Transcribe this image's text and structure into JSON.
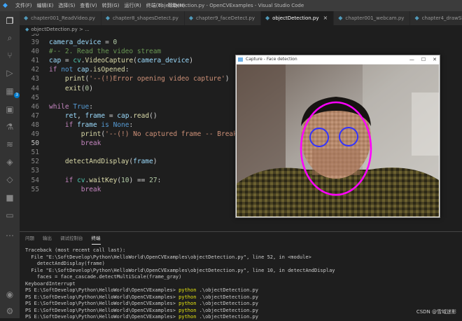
{
  "titlebar": {
    "menu": [
      "文件(F)",
      "编辑(E)",
      "选择(S)",
      "查看(V)",
      "转到(G)",
      "运行(R)",
      "终端(T)",
      "帮助(H)"
    ],
    "window_title": "objectDetection.py - OpenCVExamples - Visual Studio Code"
  },
  "activity_bar": {
    "icons": [
      "files-icon",
      "search-icon",
      "source-control-icon",
      "run-debug-icon",
      "extensions-icon",
      "remote-icon",
      "testing-icon",
      "database-icon",
      "layers-icon",
      "git-lens-icon",
      "docker-icon",
      "folder-icon",
      "more-icon",
      "account-icon",
      "settings-icon"
    ],
    "extensions_badge": "3"
  },
  "tabs": [
    {
      "label": "chapter001_ReadVideo.py",
      "active": false
    },
    {
      "label": "chapter8_shapesDetect.py",
      "active": false
    },
    {
      "label": "chapter9_faceDetect.py",
      "active": false
    },
    {
      "label": "objectDetection.py",
      "active": true
    },
    {
      "label": "chapter001_webcam.py",
      "active": false
    },
    {
      "label": "chapter4_drawShapes.py",
      "active": false
    }
  ],
  "breadcrumb": {
    "file": "objectDetection.py",
    "suffix": "> ..."
  },
  "editor": {
    "current_line": 50,
    "lines": [
      {
        "n": "39",
        "html": "<span class='var'>camera_device</span><span class='plain'> = </span><span class='num'>0</span>"
      },
      {
        "n": "40",
        "html": "<span class='cm'>#-- 2. Read the video stream</span>"
      },
      {
        "n": "41",
        "html": "<span class='var'>cap</span><span class='plain'> = </span><span class='cls'>cv</span><span class='plain'>.</span><span class='fn'>VideoCapture</span><span class='plain'>(</span><span class='var'>camera_device</span><span class='plain'>)</span>"
      },
      {
        "n": "42",
        "html": "<span class='kw'>if</span><span class='plain'> </span><span class='kw2'>not</span><span class='plain'> </span><span class='var'>cap</span><span class='plain'>.</span><span class='fn'>isOpened</span><span class='plain'>:</span>"
      },
      {
        "n": "43",
        "html": "<span class='plain'>    </span><span class='fn'>print</span><span class='plain'>(</span><span class='str'>'--(!)Error opening video capture'</span><span class='plain'>)</span>"
      },
      {
        "n": "44",
        "html": "<span class='plain'>    </span><span class='fn'>exit</span><span class='plain'>(</span><span class='num'>0</span><span class='plain'>)</span>"
      },
      {
        "n": "45",
        "html": ""
      },
      {
        "n": "46",
        "html": "<span class='kw'>while</span><span class='plain'> </span><span class='kw2'>True</span><span class='plain'>:</span>"
      },
      {
        "n": "47",
        "html": "<span class='plain'>    </span><span class='var'>ret</span><span class='plain'>, </span><span class='var'>frame</span><span class='plain'> = </span><span class='var'>cap</span><span class='plain'>.</span><span class='fn'>read</span><span class='plain'>()</span>"
      },
      {
        "n": "48",
        "html": "<span class='plain'>    </span><span class='kw'>if</span><span class='plain'> </span><span class='var'>frame</span><span class='plain'> </span><span class='kw2'>is</span><span class='plain'> </span><span class='kw2'>None</span><span class='plain'>:</span>"
      },
      {
        "n": "49",
        "html": "<span class='plain'>        </span><span class='fn'>print</span><span class='plain'>(</span><span class='str'>'--(!) No captured frame -- Break!'</span>"
      },
      {
        "n": "50",
        "html": "<span class='plain'>        </span><span class='kw'>break</span>"
      },
      {
        "n": "51",
        "html": ""
      },
      {
        "n": "52",
        "html": "<span class='plain'>    </span><span class='fn'>detectAndDisplay</span><span class='plain'>(</span><span class='var'>frame</span><span class='plain'>)</span>"
      },
      {
        "n": "53",
        "html": ""
      },
      {
        "n": "54",
        "html": "<span class='plain'>    </span><span class='kw'>if</span><span class='plain'> </span><span class='cls'>cv</span><span class='plain'>.</span><span class='fn'>waitKey</span><span class='plain'>(</span><span class='num'>10</span><span class='plain'>) == </span><span class='num'>27</span><span class='plain'>:</span>"
      },
      {
        "n": "55",
        "html": "<span class='plain'>        </span><span class='kw'>break</span>"
      }
    ]
  },
  "capture_window": {
    "title": "Capture - Face detection",
    "buttons": {
      "min": "—",
      "max": "☐",
      "close": "✕"
    }
  },
  "panel": {
    "tabs": [
      "问题",
      "输出",
      "调试控制台",
      "终端"
    ],
    "active_tab": "终端",
    "terminal_lines": [
      {
        "pre": "Traceback (most recent call last):",
        "cmd": "",
        "post": ""
      },
      {
        "pre": "  File \"E:\\SoftDevelop\\Python\\HelloWorld\\OpenCVExamples\\objectDetection.py\", line 52, in <module>",
        "cmd": "",
        "post": ""
      },
      {
        "pre": "    detectAndDisplay(frame)",
        "cmd": "",
        "post": ""
      },
      {
        "pre": "  File \"E:\\SoftDevelop\\Python\\HelloWorld\\OpenCVExamples\\objectDetection.py\", line 10, in detectAndDisplay",
        "cmd": "",
        "post": ""
      },
      {
        "pre": "    faces = face_cascade.detectMultiScale(frame_gray)",
        "cmd": "",
        "post": ""
      },
      {
        "pre": "KeyboardInterrupt",
        "cmd": "",
        "post": ""
      },
      {
        "pre": "PS E:\\SoftDevelop\\Python\\HelloWorld\\OpenCVExamples> ",
        "cmd": "python",
        "post": " .\\objectDetection.py"
      },
      {
        "pre": "PS E:\\SoftDevelop\\Python\\HelloWorld\\OpenCVExamples> ",
        "cmd": "python",
        "post": " .\\objectDetection.py"
      },
      {
        "pre": "PS E:\\SoftDevelop\\Python\\HelloWorld\\OpenCVExamples> ",
        "cmd": "python",
        "post": " .\\objectDetection.py"
      },
      {
        "pre": "PS E:\\SoftDevelop\\Python\\HelloWorld\\OpenCVExamples> ",
        "cmd": "python",
        "post": " .\\objectDetection.py"
      },
      {
        "pre": "PS E:\\SoftDevelop\\Python\\HelloWorld\\OpenCVExamples> ",
        "cmd": "python",
        "post": " .\\objectDetection.py"
      }
    ]
  },
  "watermark": "CSDN @雪域迷影",
  "colors": {
    "accent": "#007acc",
    "face_ellipse": "#ff00ff",
    "eye_circle": "#3333ff"
  }
}
